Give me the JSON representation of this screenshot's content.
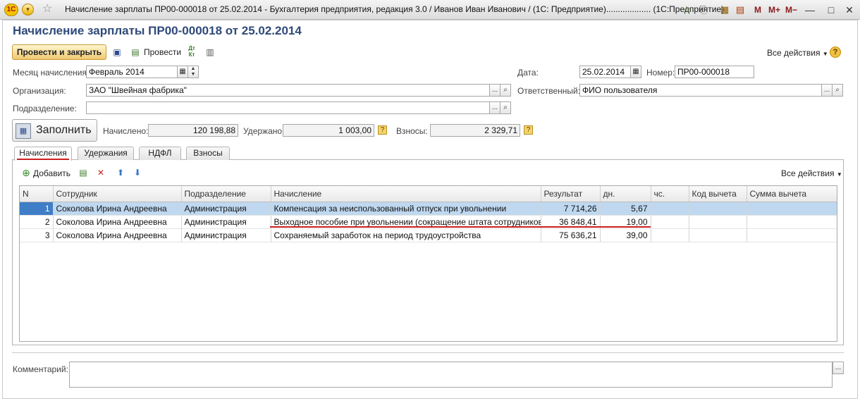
{
  "window": {
    "title": "Начисление зарплаты ПР00-000018 от 25.02.2014 - Бухгалтерия предприятия, редакция 3.0 / Иванов Иван Иванович / (1С: Предприятие)...................  (1С:Предприятие)",
    "logo": "1С",
    "mem_buttons": [
      "M",
      "M+",
      "M−"
    ]
  },
  "document": {
    "title": "Начисление зарплаты ПР00-000018 от 25.02.2014"
  },
  "toolbar": {
    "post_and_close": "Провести и закрыть",
    "post": "Провести",
    "all_actions": "Все действия",
    "dtkt": "Дт Кт"
  },
  "form": {
    "month_label": "Месяц начисления:",
    "month_value": "Февраль 2014",
    "date_label": "Дата:",
    "date_value": "25.02.2014",
    "number_label": "Номер:",
    "number_value": "ПР00-000018",
    "org_label": "Организация:",
    "org_value": "ЗАО \"Швейная фабрика\"",
    "responsible_label": "Ответственный:",
    "responsible_value": "ФИО пользователя",
    "dept_label": "Подразделение:",
    "dept_value": "",
    "fill_button": "Заполнить",
    "accrued_label": "Начислено:",
    "accrued_value": "120 198,88",
    "withheld_label": "Удержано:",
    "withheld_value": "1 003,00",
    "contrib_label": "Взносы:",
    "contrib_value": "2 329,71"
  },
  "tabs": [
    "Начисления",
    "Удержания",
    "НДФЛ",
    "Взносы"
  ],
  "grid_toolbar": {
    "add": "Добавить",
    "all_actions": "Все действия"
  },
  "grid": {
    "columns": [
      "N",
      "Сотрудник",
      "Подразделение",
      "Начисление",
      "Результат",
      "дн.",
      "чс.",
      "Код вычета",
      "Сумма вычета"
    ],
    "rows": [
      {
        "n": "1",
        "employee": "Соколова Ирина Андреевна",
        "dept": "Администрация",
        "accrual": "Компенсация за неиспользованный отпуск при увольнении",
        "result": "7 714,26",
        "days": "5,67",
        "hours": "",
        "code": "",
        "deduction": ""
      },
      {
        "n": "2",
        "employee": "Соколова Ирина Андреевна",
        "dept": "Администрация",
        "accrual": "Выходное пособие при увольнении (сокращение штата сотрудников)",
        "result": "36 848,41",
        "days": "19,00",
        "hours": "",
        "code": "",
        "deduction": ""
      },
      {
        "n": "3",
        "employee": "Соколова Ирина Андреевна",
        "dept": "Администрация",
        "accrual": "Сохраняемый заработок на период трудоустройства",
        "result": "75 636,21",
        "days": "39,00",
        "hours": "",
        "code": "",
        "deduction": ""
      }
    ]
  },
  "comment": {
    "label": "Комментарий:",
    "value": ""
  },
  "colors": {
    "title_blue": "#2f4a7a",
    "selection": "#bfd8f0",
    "highlight_red": "#cc1f1f"
  }
}
